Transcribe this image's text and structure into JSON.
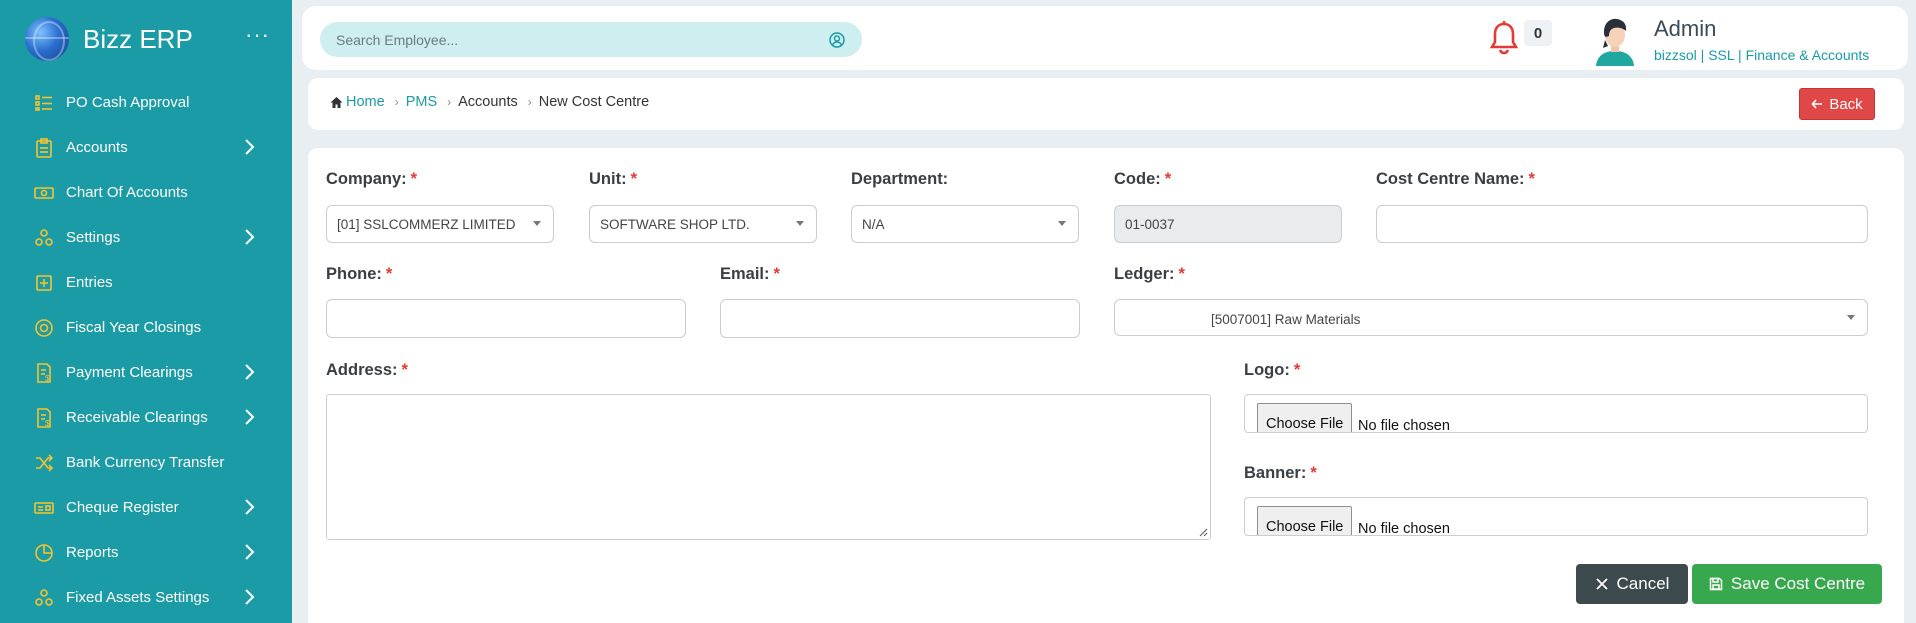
{
  "sidebar": {
    "brand": "Bizz ERP",
    "menu_icon": "more-horizontal-icon",
    "items": [
      {
        "label": "PO Cash Approval",
        "icon": "list-icon",
        "has_children": false
      },
      {
        "label": "Accounts",
        "icon": "clipboard-icon",
        "has_children": true
      },
      {
        "label": "Chart Of Accounts",
        "icon": "money-icon",
        "has_children": false
      },
      {
        "label": "Settings",
        "icon": "cluster-icon",
        "has_children": true
      },
      {
        "label": "Entries",
        "icon": "plus-square-icon",
        "has_children": false
      },
      {
        "label": "Fiscal Year Closings",
        "icon": "target-icon",
        "has_children": false
      },
      {
        "label": "Payment Clearings",
        "icon": "invoice-dollar-icon",
        "has_children": true
      },
      {
        "label": "Receivable Clearings",
        "icon": "invoice-dollar-icon",
        "has_children": true
      },
      {
        "label": "Bank Currency Transfer",
        "icon": "shuffle-icon",
        "has_children": false
      },
      {
        "label": "Cheque Register",
        "icon": "cheque-icon",
        "has_children": true
      },
      {
        "label": "Reports",
        "icon": "pie-chart-icon",
        "has_children": true
      },
      {
        "label": "Fixed Assets Settings",
        "icon": "cluster-icon",
        "has_children": true
      }
    ]
  },
  "header": {
    "search_placeholder": "Search Employee...",
    "notification_count": "0",
    "user_name": "Admin",
    "user_org": "bizzsol | SSL  | Finance & Accounts"
  },
  "breadcrumb": {
    "home": "Home",
    "items": [
      "PMS",
      "Accounts",
      "New Cost Centre"
    ],
    "back_label": "Back"
  },
  "form": {
    "company": {
      "label": "Company:",
      "value": "[01] SSLCOMMERZ LIMITED"
    },
    "unit": {
      "label": "Unit:",
      "value": "SOFTWARE SHOP LTD."
    },
    "department": {
      "label": "Department:",
      "value": "N/A"
    },
    "code": {
      "label": "Code:",
      "value": "01-0037"
    },
    "cost_centre_name": {
      "label": "Cost Centre Name:",
      "value": ""
    },
    "phone": {
      "label": "Phone:",
      "value": ""
    },
    "email": {
      "label": "Email:",
      "value": ""
    },
    "ledger": {
      "label": "Ledger:",
      "value": "[5007001] Raw Materials"
    },
    "address": {
      "label": "Address:",
      "value": ""
    },
    "logo": {
      "label": "Logo:",
      "button": "Choose File",
      "status": "No file chosen"
    },
    "banner": {
      "label": "Banner:",
      "button": "Choose File",
      "status": "No file chosen"
    },
    "required_mark": "*",
    "cancel_label": "Cancel",
    "save_label": "Save Cost Centre"
  },
  "colors": {
    "sidebar": "#1a9ba6",
    "accent": "#1a9ba6",
    "icon_yellow": "#f4c430",
    "danger": "#e04848",
    "success": "#38a84f",
    "dark_button": "#3c4a4d"
  }
}
